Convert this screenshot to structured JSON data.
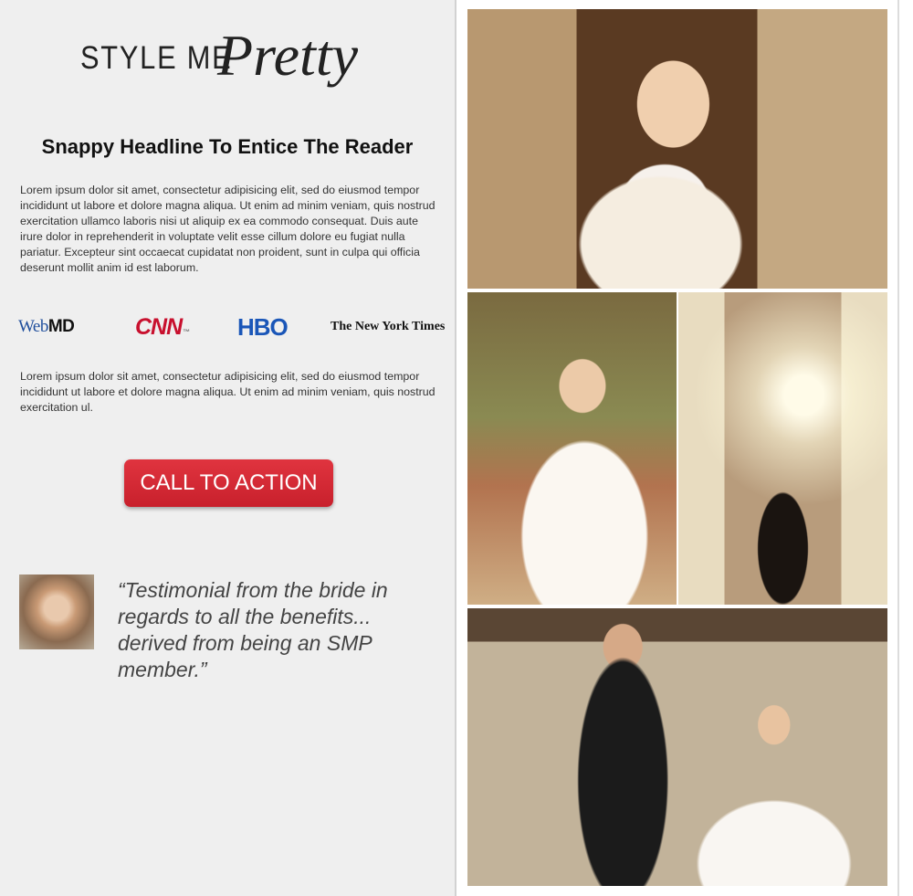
{
  "logo": {
    "plain": "STYLE ME",
    "script": "Pretty"
  },
  "headline": "Snappy Headline To Entice The Reader",
  "paragraph1": "Lorem ipsum dolor sit amet, consectetur adipisicing elit, sed do eiusmod tempor incididunt ut labore et dolore magna aliqua. Ut enim ad minim veniam, quis nostrud exercitation ullamco laboris nisi ut aliquip ex ea commodo consequat. Duis aute irure dolor in reprehenderit in voluptate velit esse cillum dolore eu fugiat nulla pariatur. Excepteur sint occaecat cupidatat non proident, sunt in culpa qui officia deserunt mollit anim id est laborum.",
  "media_logos": {
    "webmd": {
      "web": "Web",
      "md": "MD"
    },
    "cnn": {
      "text": "CNN",
      "tm": "™"
    },
    "hbo": "HBO",
    "nyt": "The New York Times"
  },
  "paragraph2": "Lorem ipsum dolor sit amet, consectetur adipisicing elit, sed do eiusmod tempor incididunt ut labore et dolore magna aliqua. Ut enim ad minim veniam, quis nostrud exercitation ul.",
  "cta": {
    "label": "CALL TO ACTION"
  },
  "testimonial": {
    "quote": "“Testimonial from the bride in regards to all the benefits... derived from being an SMP member.”"
  },
  "colors": {
    "cta": "#d2262f",
    "background": "#efefef",
    "cnn": "#c8102e",
    "hbo": "#1a56b8",
    "webmd": "#1f4e9c"
  },
  "icons": {
    "avatar": "bride-avatar-photo"
  }
}
